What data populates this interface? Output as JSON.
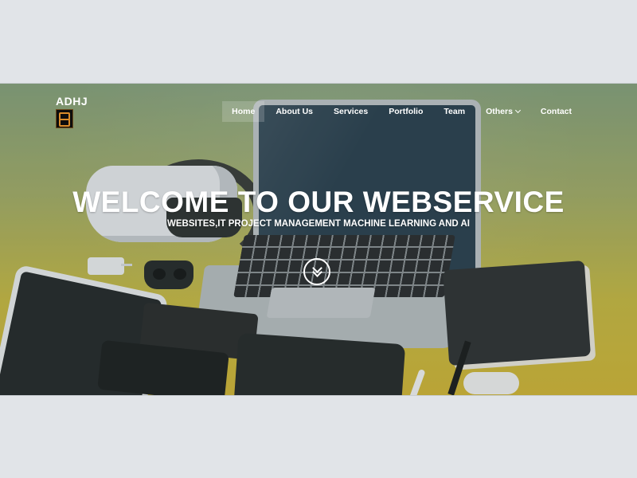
{
  "brand": {
    "name": "ADHJ",
    "logo_icon": "adhj-logo-icon"
  },
  "nav": {
    "items": [
      {
        "label": "Home",
        "active": true
      },
      {
        "label": "About Us"
      },
      {
        "label": "Services"
      },
      {
        "label": "Portfolio"
      },
      {
        "label": "Team"
      },
      {
        "label": "Others",
        "has_dropdown": true,
        "icon": "chevron-down-icon"
      },
      {
        "label": "Contact"
      }
    ]
  },
  "hero": {
    "title": "WELCOME TO OUR WEBSERVICE",
    "subtitle": "WEBSITES,IT PROJECT MANAGEMENT MACHINE LEARNING AND AI",
    "scroll_icon": "double-chevron-down-icon"
  },
  "colors": {
    "text": "#ffffff",
    "background_top": "#86a17c",
    "background_bottom": "#d2b636",
    "page_margin": "#e1e4e8"
  }
}
